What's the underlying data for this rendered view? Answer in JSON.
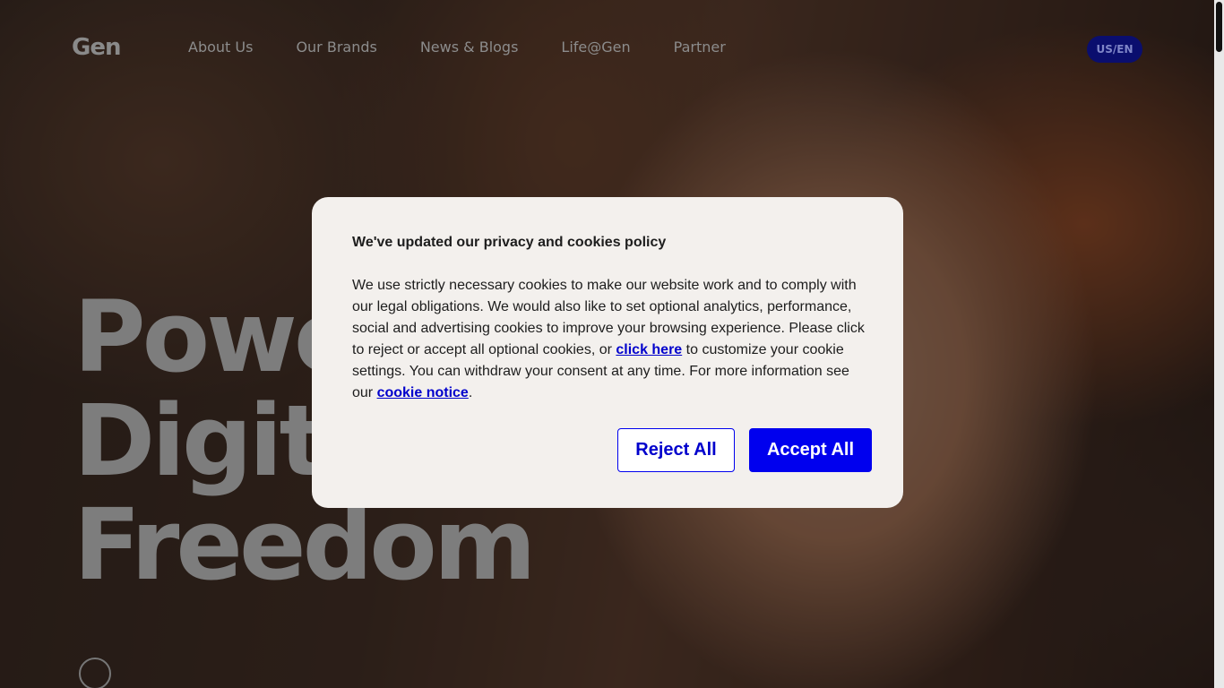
{
  "site": {
    "logo_text": "Gen",
    "nav": [
      {
        "label": "About Us"
      },
      {
        "label": "Our Brands"
      },
      {
        "label": "News & Blogs"
      },
      {
        "label": "Life@Gen"
      },
      {
        "label": "Partner"
      }
    ],
    "locale_label": "US/EN"
  },
  "hero": {
    "headline_lines": [
      "Powe",
      "Digit",
      "Freedom"
    ]
  },
  "cookie_modal": {
    "title": "We've updated our privacy and cookies policy",
    "body_part1": "We use strictly necessary cookies to make our website work and to comply with our legal obligations. We would also like to set optional analytics, performance, social and advertising cookies to improve your browsing experience. Please click to reject or accept all optional cookies, or ",
    "click_here_link": "click here",
    "body_part2": " to customize your cookie settings. You can withdraw your consent at any time. For more information see our ",
    "cookie_notice_link": "cookie notice",
    "body_part3": ".",
    "reject_label": "Reject All",
    "accept_label": "Accept All"
  },
  "colors": {
    "accent_blue": "#0000ee",
    "locale_bg": "#0a0e6e",
    "modal_bg": "#f3f0ed"
  }
}
